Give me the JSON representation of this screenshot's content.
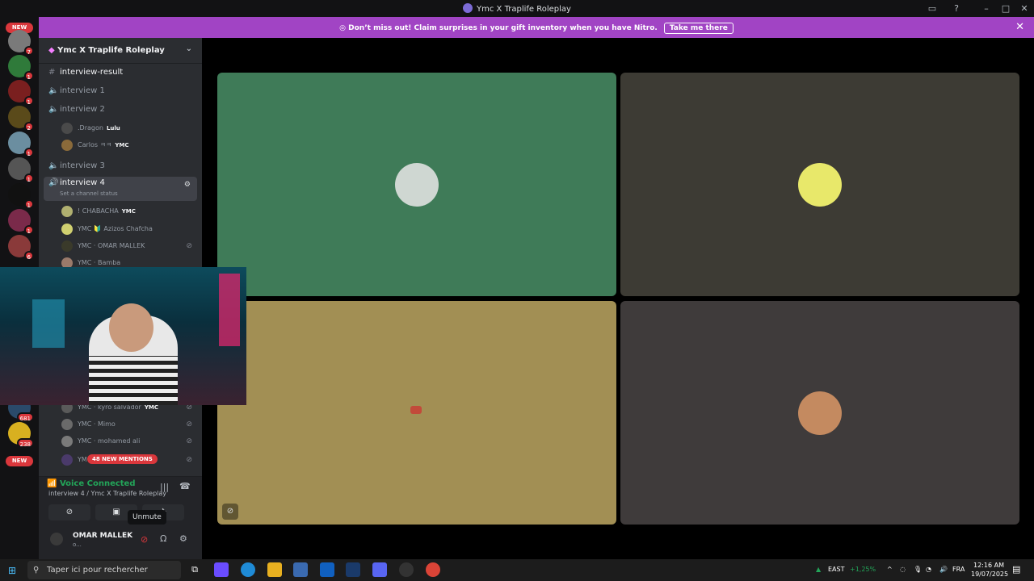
{
  "window": {
    "title": "Ymc X Traplife Roleplay"
  },
  "rail": {
    "top_pill": "NEW",
    "top_pill_count": "2",
    "badges": [
      "7",
      "1",
      "1",
      "2",
      "1",
      "1",
      "1",
      "1",
      "6"
    ],
    "lower_badges": [
      "681",
      "238"
    ],
    "bottom_pill": "NEW"
  },
  "banner": {
    "text": "Don’t miss out! Claim surprises in your gift inventory when you have Nitro.",
    "button": "Take me there"
  },
  "server": {
    "name": "Ymc X Traplife Roleplay"
  },
  "channels": {
    "text_channel": "interview-result",
    "interview1": "interview 1",
    "interview2": "interview 2",
    "interview3": "interview 3",
    "interview4": "interview 4",
    "status_hint": "Set a channel status",
    "members_i2": [
      {
        "name": ".Dragon",
        "tag": "Lulu"
      },
      {
        "name": "Carlos ㅋㅋ",
        "tag": "YMC"
      }
    ],
    "members_i4": [
      {
        "name": "! CHABACHA",
        "tag": "YMC"
      },
      {
        "name": "YMC 🔰 Azizos Chafcha",
        "tag": ""
      },
      {
        "name": "YMC · OMAR MALLEK",
        "tag": ""
      },
      {
        "name": "YMC · Bamba",
        "tag": ""
      },
      {
        "name": "YMC · kyro salvador",
        "tag": "YMC"
      },
      {
        "name": "YMC · Mimo",
        "tag": ""
      },
      {
        "name": "YMC · mohamed ali",
        "tag": ""
      },
      {
        "name": "YM",
        "tag": ""
      }
    ],
    "mentions_pill": "48 NEW MENTIONS"
  },
  "voice": {
    "status": "Voice Connected",
    "location": "interview 4 / Ymc X Traplife Roleplay"
  },
  "user": {
    "name": "OMAR MALLEK",
    "sub": "o..."
  },
  "tooltip": "Unmute",
  "taskbar": {
    "search_placeholder": "Taper ici pour rechercher",
    "market": "EAST",
    "market_change": "+1,25%",
    "lang": "FRA",
    "time": "12:16 AM",
    "date": "19/07/2025"
  },
  "colors": {
    "tile1": "#3f7b58",
    "tile2": "#3d3b34",
    "tile3": "#a28f54",
    "tile4": "#3f3b3b",
    "nitro": "#a144c4",
    "voice_green": "#23a559"
  }
}
